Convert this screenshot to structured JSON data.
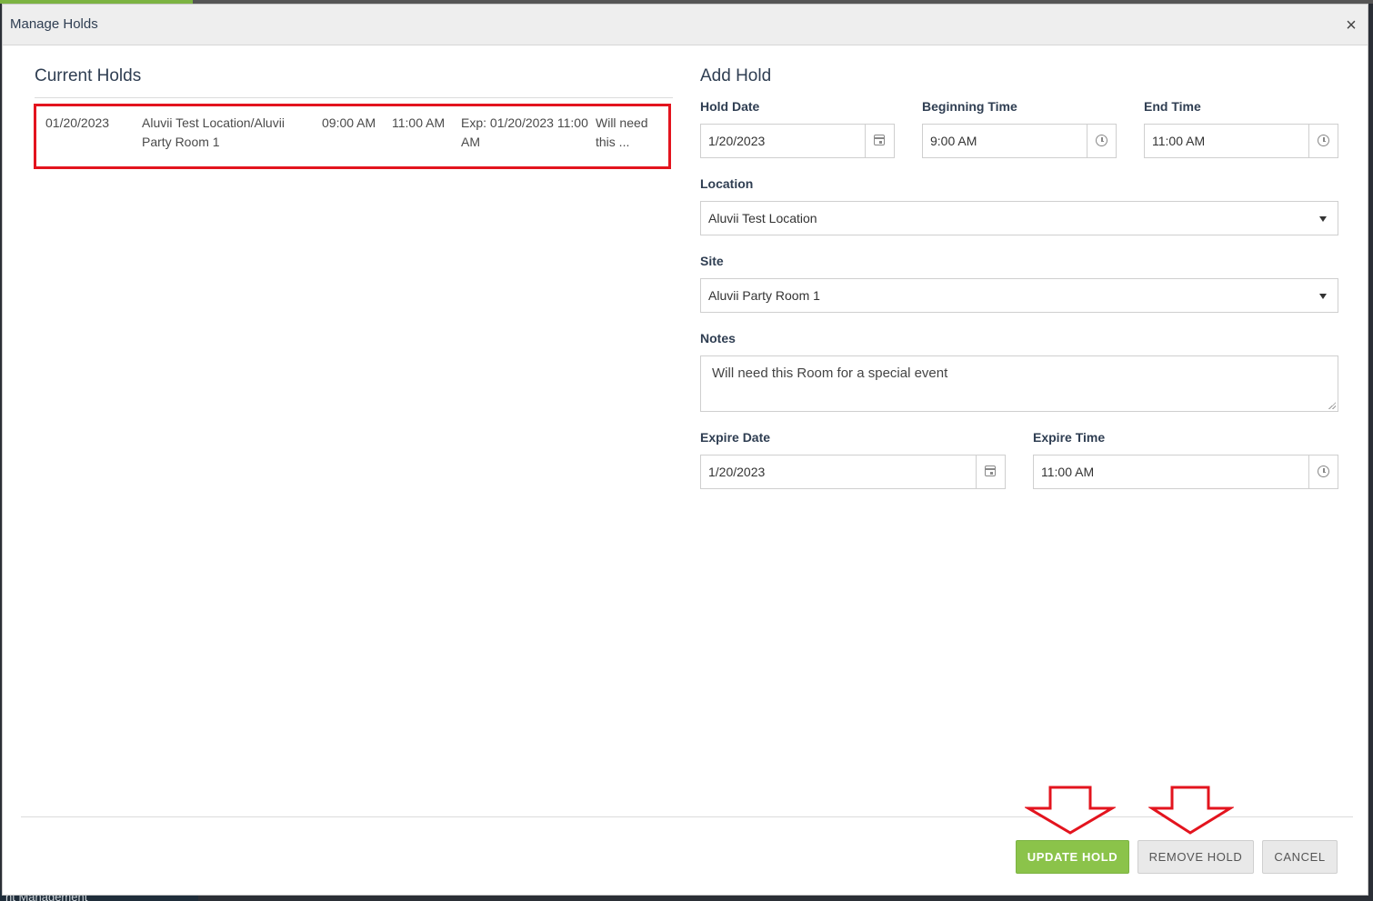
{
  "modal": {
    "title": "Manage Holds",
    "close_glyph": "×"
  },
  "current_holds": {
    "title": "Current Holds",
    "rows": [
      {
        "date": "01/20/2023",
        "location": "Aluvii Test Location/Aluvii Party Room 1",
        "begin": "09:00 AM",
        "end": "11:00 AM",
        "expires": "Exp: 01/20/2023 11:00 AM",
        "notes": "Will need this ..."
      }
    ]
  },
  "add_hold": {
    "title": "Add Hold",
    "hold_date": {
      "label": "Hold Date",
      "value": "1/20/2023",
      "icon": "calendar-icon"
    },
    "beginning_time": {
      "label": "Beginning Time",
      "value": "9:00 AM",
      "icon": "clock-icon"
    },
    "end_time": {
      "label": "End Time",
      "value": "11:00 AM",
      "icon": "clock-icon"
    },
    "location": {
      "label": "Location",
      "value": "Aluvii Test Location"
    },
    "site": {
      "label": "Site",
      "value": "Aluvii Party Room 1"
    },
    "notes": {
      "label": "Notes",
      "value": "Will need this Room for a special event"
    },
    "expire_date": {
      "label": "Expire Date",
      "value": "1/20/2023",
      "icon": "calendar-icon"
    },
    "expire_time": {
      "label": "Expire Time",
      "value": "11:00 AM",
      "icon": "clock-icon"
    }
  },
  "buttons": {
    "update": "UPDATE HOLD",
    "remove": "REMOVE HOLD",
    "cancel": "CANCEL"
  },
  "background": {
    "sidebar_text": "nt Management"
  },
  "colors": {
    "primary": "#8bc34a",
    "highlight": "#e3141e",
    "heading": "#2f3e52"
  }
}
